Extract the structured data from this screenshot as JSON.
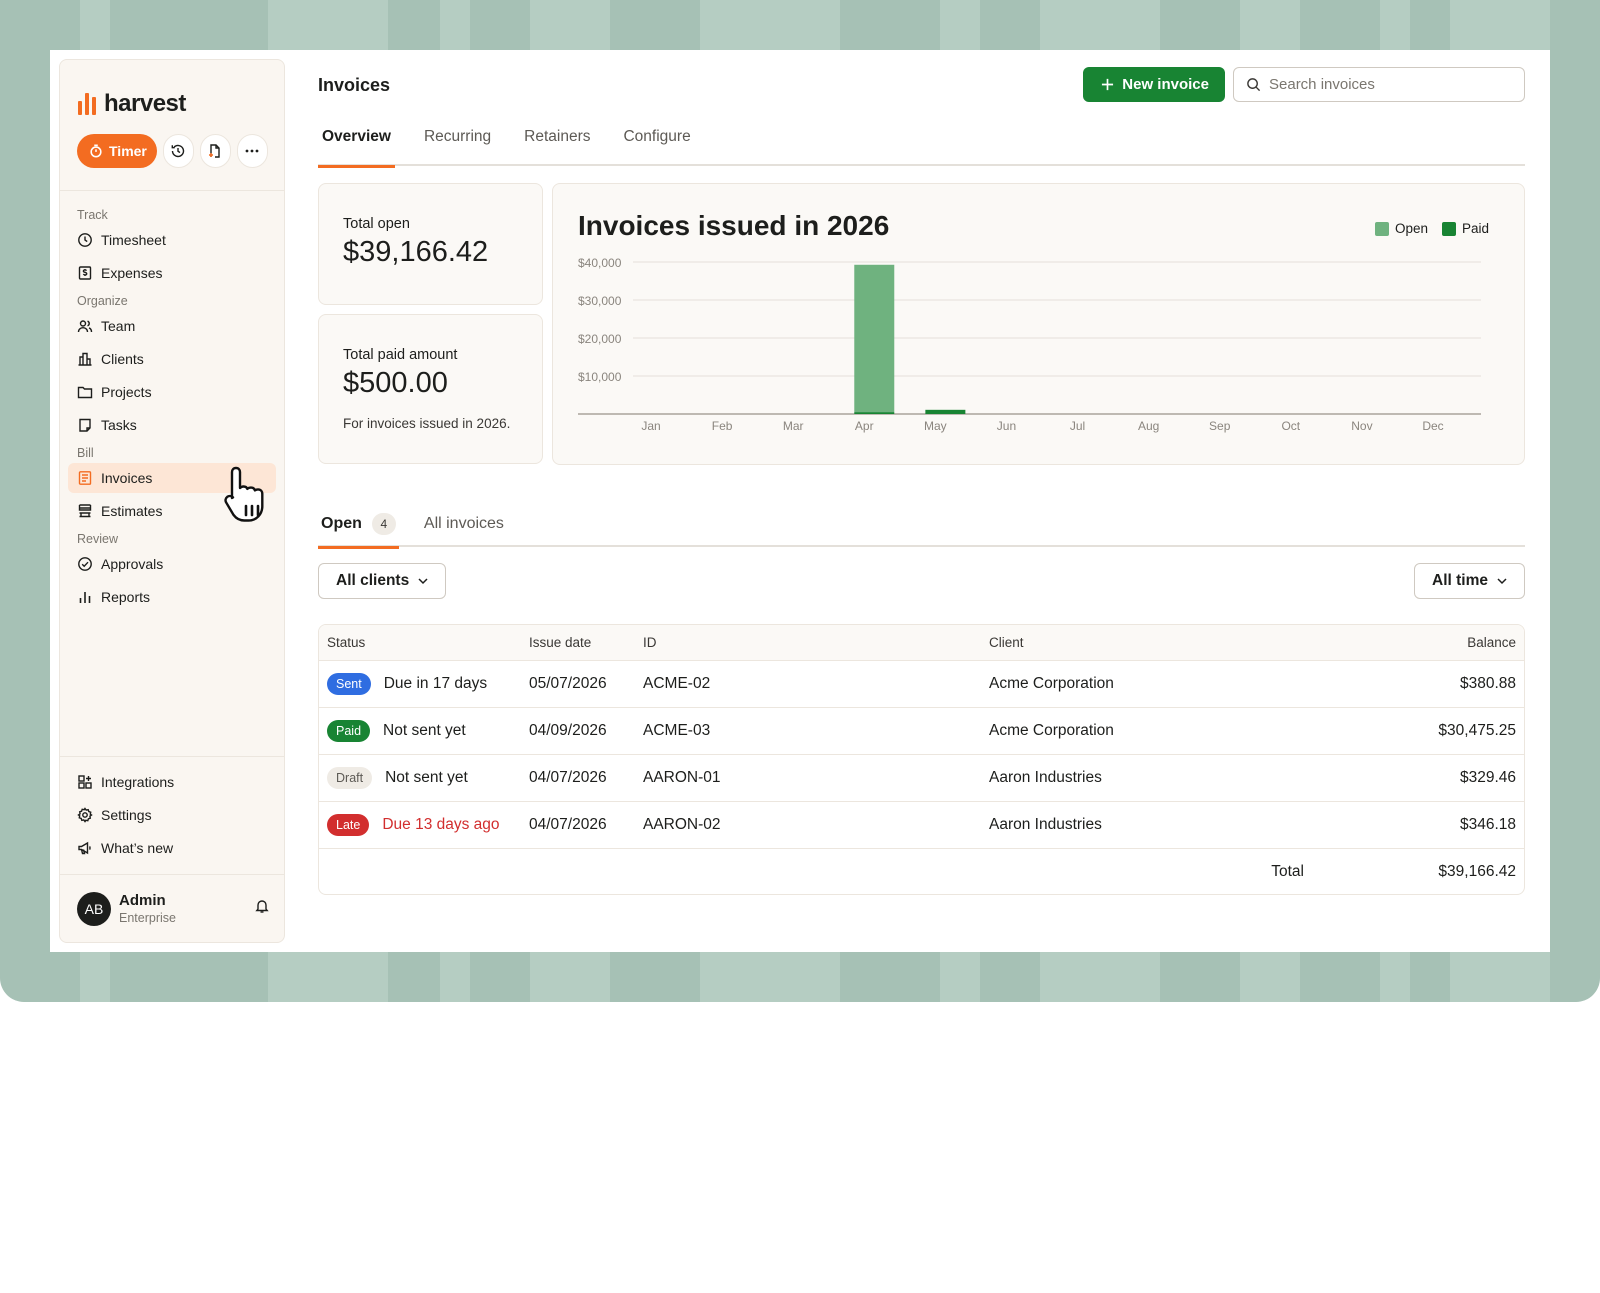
{
  "colors": {
    "brand_orange": "#f36c21",
    "primary_green": "#188433",
    "chart_open": "#6fb27f",
    "chart_paid": "#188433",
    "badge_sent": "#2f6de1",
    "badge_paid": "#188433",
    "badge_draft": "#efebe5",
    "badge_late": "#d22e2e"
  },
  "sidebar": {
    "logo_text": "harvest",
    "timer_label": "Timer",
    "quick_icons": [
      "clock-history-icon",
      "new-document-icon",
      "more-icon"
    ],
    "sections": [
      {
        "label": "Track",
        "items": [
          {
            "label": "Timesheet",
            "icon": "clock-icon"
          },
          {
            "label": "Expenses",
            "icon": "receipt-icon"
          }
        ]
      },
      {
        "label": "Organize",
        "items": [
          {
            "label": "Team",
            "icon": "team-icon"
          },
          {
            "label": "Clients",
            "icon": "building-icon"
          },
          {
            "label": "Projects",
            "icon": "folder-icon"
          },
          {
            "label": "Tasks",
            "icon": "task-icon"
          }
        ]
      },
      {
        "label": "Bill",
        "items": [
          {
            "label": "Invoices",
            "icon": "invoice-icon",
            "active": true
          },
          {
            "label": "Estimates",
            "icon": "estimate-icon"
          }
        ]
      },
      {
        "label": "Review",
        "items": [
          {
            "label": "Approvals",
            "icon": "check-circle-icon"
          },
          {
            "label": "Reports",
            "icon": "bar-chart-icon"
          }
        ]
      }
    ],
    "bottom_items": [
      {
        "label": "Integrations",
        "icon": "integrations-icon"
      },
      {
        "label": "Settings",
        "icon": "gear-icon"
      },
      {
        "label": "What’s new",
        "icon": "megaphone-icon"
      }
    ],
    "user": {
      "initials": "AB",
      "name": "Admin",
      "plan": "Enterprise"
    }
  },
  "header": {
    "title": "Invoices",
    "new_button": "New invoice",
    "search_placeholder": "Search invoices"
  },
  "tabs": [
    "Overview",
    "Recurring",
    "Retainers",
    "Configure"
  ],
  "stats": {
    "open_label": "Total open",
    "open_value": "$39,166.42",
    "paid_label": "Total paid amount",
    "paid_value": "$500.00",
    "paid_note": "For invoices issued in 2026."
  },
  "chart_data": {
    "type": "bar",
    "stacked": true,
    "title": "Invoices issued in 2026",
    "categories": [
      "Jan",
      "Feb",
      "Mar",
      "Apr",
      "May",
      "Jun",
      "Jul",
      "Aug",
      "Sep",
      "Oct",
      "Nov",
      "Dec"
    ],
    "series": [
      {
        "name": "Open",
        "values": [
          0,
          0,
          0,
          38770,
          0,
          0,
          0,
          0,
          0,
          0,
          0,
          0
        ]
      },
      {
        "name": "Paid",
        "values": [
          0,
          0,
          0,
          500,
          1100,
          0,
          0,
          0,
          0,
          0,
          0,
          0
        ]
      }
    ],
    "y_ticks": [
      "$10,000",
      "$20,000",
      "$30,000",
      "$40,000"
    ],
    "ylim": [
      0,
      40000
    ],
    "grid": true,
    "legend": "top-right"
  },
  "list_tabs": {
    "open_label": "Open",
    "open_count": "4",
    "all_label": "All invoices"
  },
  "filters": {
    "clients": "All clients",
    "time": "All time"
  },
  "table": {
    "headers": {
      "status": "Status",
      "issue_date": "Issue date",
      "id": "ID",
      "client": "Client",
      "balance": "Balance"
    },
    "rows": [
      {
        "badge": "Sent",
        "status_text": "Due in 17 days",
        "date": "05/07/2026",
        "id": "ACME-02",
        "client": "Acme Corporation",
        "balance": "$380.88"
      },
      {
        "badge": "Paid",
        "status_text": "Not sent yet",
        "date": "04/09/2026",
        "id": "ACME-03",
        "client": "Acme Corporation",
        "balance": "$30,475.25"
      },
      {
        "badge": "Draft",
        "status_text": "Not sent yet",
        "date": "04/07/2026",
        "id": "AARON-01",
        "client": "Aaron Industries",
        "balance": "$329.46"
      },
      {
        "badge": "Late",
        "status_text": "Due 13 days ago",
        "date": "04/07/2026",
        "id": "AARON-02",
        "client": "Aaron Industries",
        "balance": "$346.18"
      }
    ],
    "total_label": "Total",
    "total_value": "$39,166.42"
  }
}
